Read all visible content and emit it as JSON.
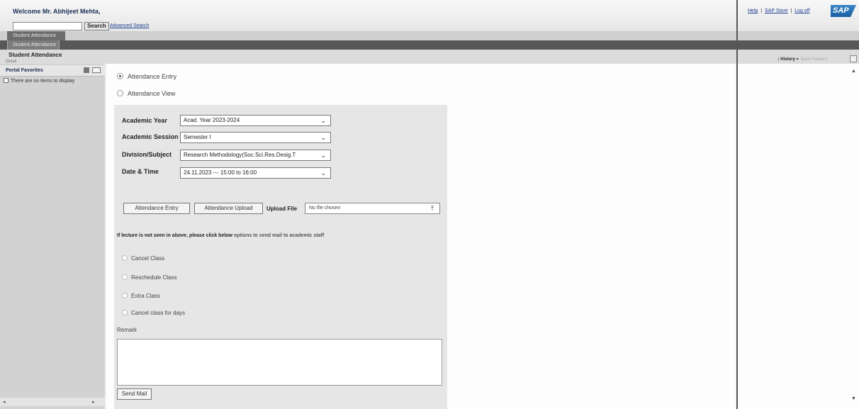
{
  "header": {
    "welcome": "Welcome Mr. Abhijeet Mehta,",
    "search_label": "Search",
    "advanced_search": "Advanced Search",
    "links": [
      "Help",
      "SAP Store",
      "Log off"
    ],
    "separator": "|",
    "logo": "SAP"
  },
  "nav": {
    "level1_tab": "Student Attendance",
    "level2_tab": "Student Attendance"
  },
  "page": {
    "title": "Student Attendance",
    "detail_label": "Detail",
    "history": "History",
    "back": "Back",
    "forward": "Forward"
  },
  "sidebar": {
    "title": "Portal Favorites",
    "empty_message": "There are no items to display"
  },
  "mode": {
    "entry_label": "Attendance Entry",
    "view_label": "Attendance View",
    "selected": "Attendance Entry"
  },
  "form": {
    "academic_year_label": "Academic Year",
    "academic_year_value": "Acad. Year 2023-2024",
    "academic_session_label": "Academic Session",
    "academic_session_value": "Semester I",
    "division_label": "Division/Subject",
    "division_value": "Research Methodology(Soc.Sci.Res.Desig.T",
    "datetime_label": "Date & Time",
    "datetime_value": "24.11.2023 --- 15:00 to 16:00"
  },
  "actions": {
    "attendance_entry_button": "Attendance Entry",
    "attendance_upload_button": "Attendance Upload",
    "upload_file_label": "Upload File",
    "file_placeholder": "No file chosen"
  },
  "notice": {
    "part1": "If lecture is not seen in above, please click below",
    "part2": "options to send mail to academic staff"
  },
  "options": [
    "Cancel Class",
    "Reschedule Class",
    "Extra Class",
    "Cancel class for days"
  ],
  "remark": {
    "label": "Remark",
    "send_button": "Send Mail"
  }
}
